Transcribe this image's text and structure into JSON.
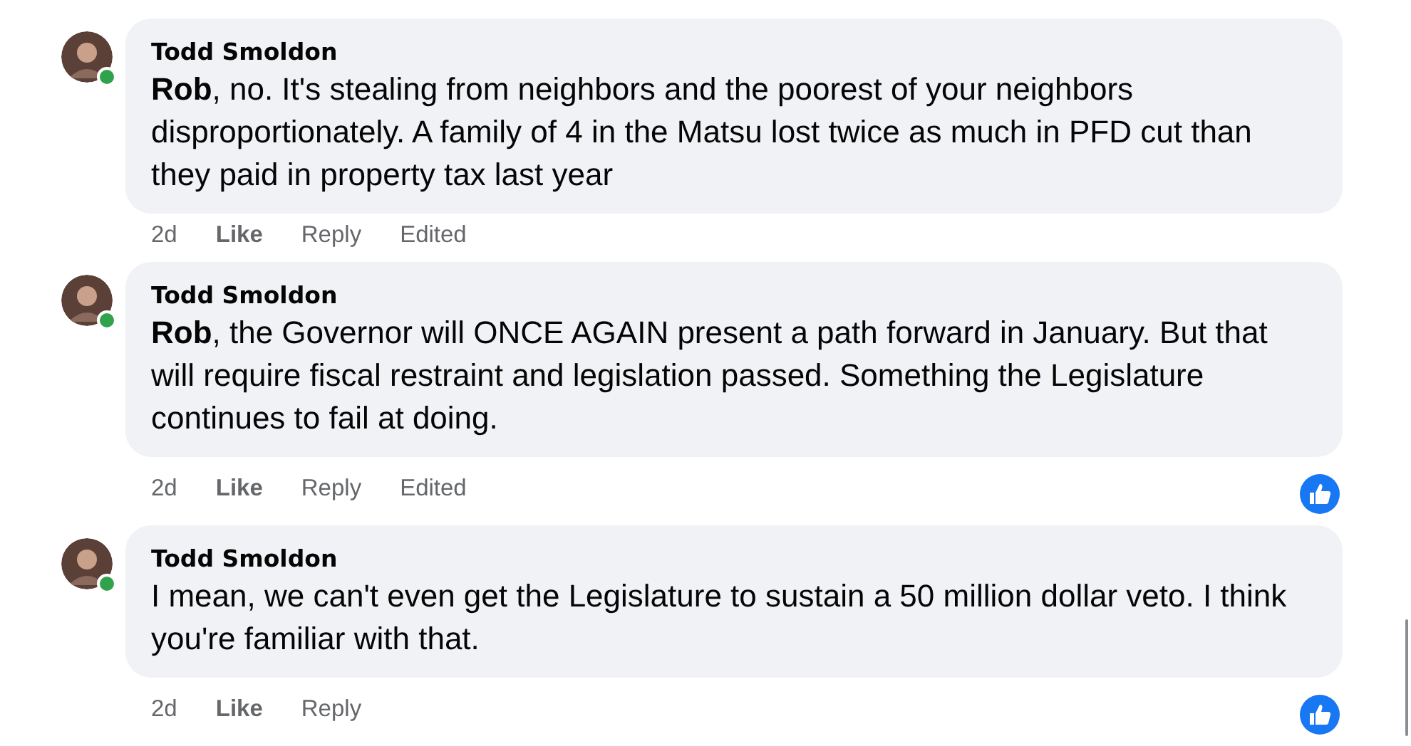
{
  "comments": [
    {
      "author": "Todd Smoldon",
      "online": true,
      "text": "**Rob**, no. It's stealing from neighbors and the poorest of your neighbors disproportionately. A family of 4 in the Matsu lost twice as much in PFD cut than they paid in property tax last year",
      "time": "2d",
      "like": "Like",
      "reply": "Reply",
      "edited": "Edited",
      "liked": false
    },
    {
      "author": "Todd Smoldon",
      "online": true,
      "text": "**Rob**, the Governor will ONCE AGAIN present a path forward in January. But that will require fiscal restraint and legislation passed. Something the Legislature continues to fail at doing.",
      "time": "2d",
      "like": "Like",
      "reply": "Reply",
      "edited": "Edited",
      "liked": true
    },
    {
      "author": "Todd Smoldon",
      "online": true,
      "text": "I mean, we can't even get the Legislature to sustain a 50 million dollar veto. I think you're familiar with that.",
      "time": "2d",
      "like": "Like",
      "reply": "Reply",
      "liked": true
    }
  ]
}
